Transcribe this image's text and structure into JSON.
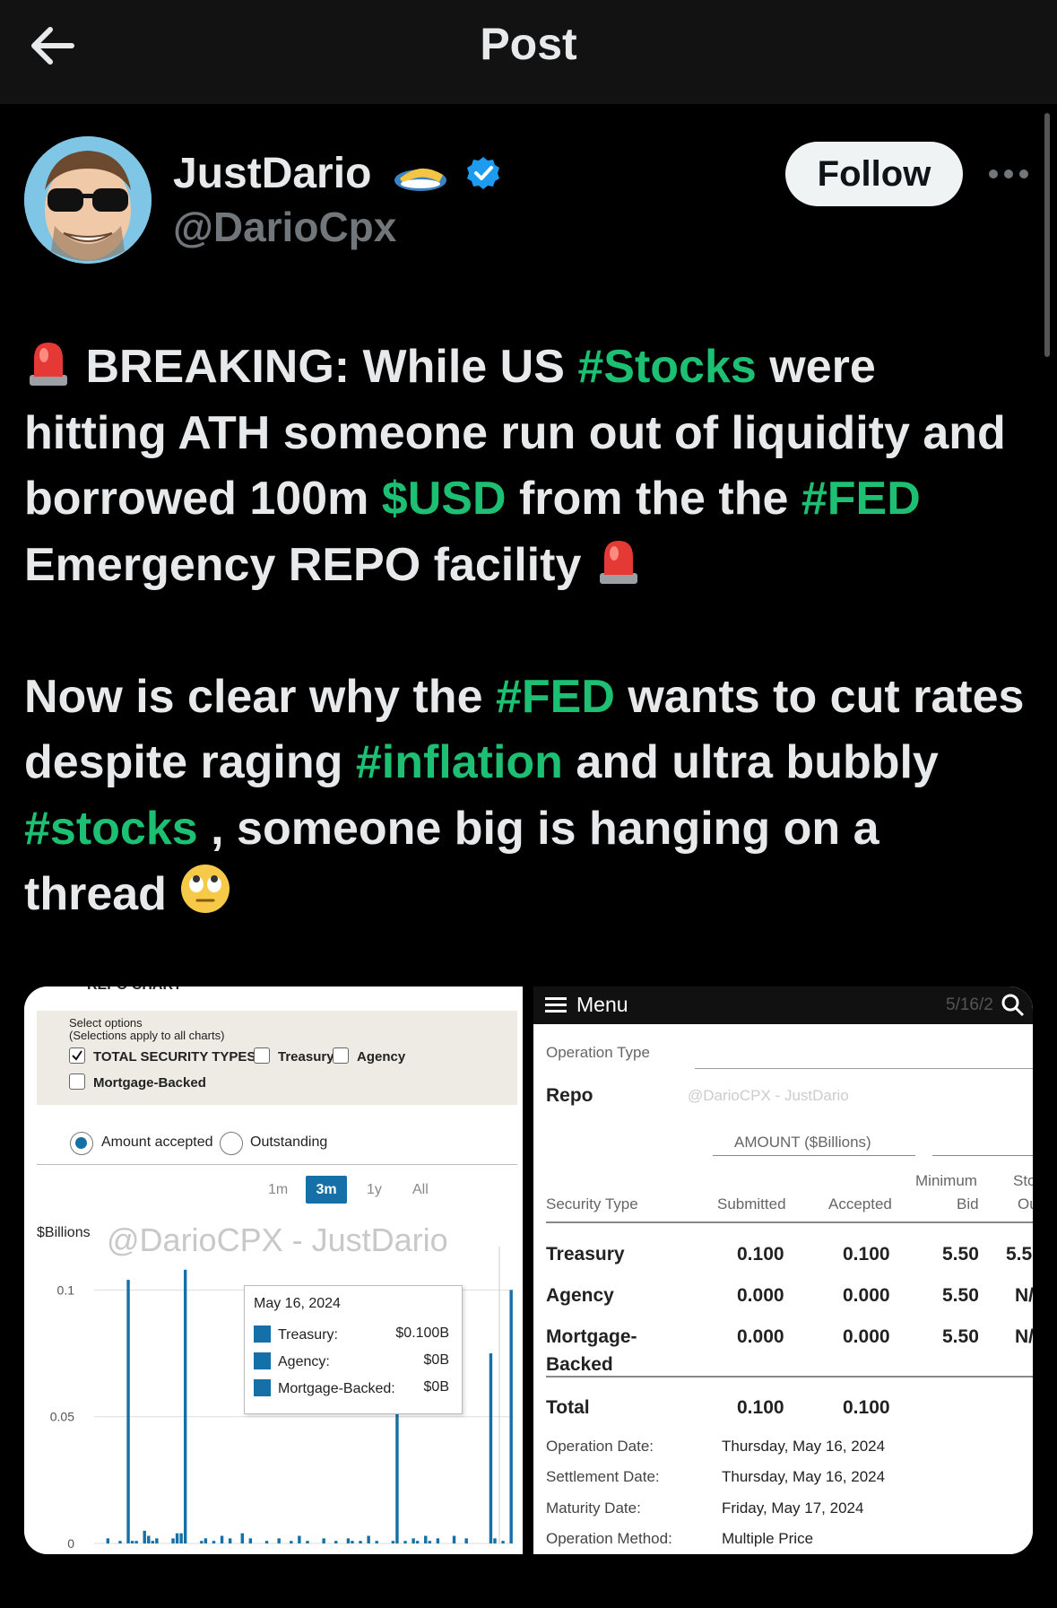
{
  "header": {
    "title": "Post"
  },
  "author": {
    "display_name": "JustDario",
    "handle": "@DarioCpx",
    "follow_label": "Follow"
  },
  "post": {
    "p1": {
      "t1": "BREAKING: While US ",
      "tag1": "#Stocks",
      "t2": " were hitting ATH someone run out of liquidity and borrowed 100m ",
      "tag2": "$USD",
      "t3": " from the the ",
      "tag3": "#FED",
      "t4": " Emergency REPO facility "
    },
    "p2": {
      "t1": "Now is clear why the ",
      "tag1": "#FED",
      "t2": " wants to cut rates despite raging ",
      "tag2": "#inflation",
      "t3": " and ultra bubbly ",
      "tag3": "#stocks",
      "t4": " , someone big is hanging on a thread "
    }
  },
  "image_left": {
    "cut_header": "REPO CHART",
    "select_title": "Select options",
    "select_sub": "(Selections apply to all charts)",
    "checks": [
      {
        "label": "TOTAL SECURITY TYPES",
        "checked": true
      },
      {
        "label": "Treasury",
        "checked": false
      },
      {
        "label": "Agency",
        "checked": false
      },
      {
        "label": "Mortgage-Backed",
        "checked": false
      }
    ],
    "radios": [
      {
        "label": "Amount accepted",
        "selected": true
      },
      {
        "label": "Outstanding",
        "selected": false
      }
    ],
    "ranges": [
      "1m",
      "3m",
      "1y",
      "All"
    ],
    "active_range": "3m",
    "watermark": "@DarioCPX - JustDario",
    "tooltip": {
      "date": "May 16, 2024",
      "rows": [
        {
          "label": "Treasury:",
          "value": "$0.100B"
        },
        {
          "label": "Agency:",
          "value": "$0B"
        },
        {
          "label": "Mortgage-Backed:",
          "value": "$0B"
        }
      ]
    }
  },
  "chart_data": {
    "type": "bar",
    "ylabel": "$Billions",
    "ylim": [
      0,
      0.115
    ],
    "yticks": [
      "0.1",
      "0.05",
      "0"
    ],
    "ytick_values": [
      0.1,
      0.05,
      0
    ],
    "values": [
      0,
      0,
      0,
      0.002,
      0,
      0,
      0.001,
      0,
      0.104,
      0.001,
      0.001,
      0,
      0.005,
      0.003,
      0.001,
      0.002,
      0,
      0,
      0,
      0.002,
      0.004,
      0.004,
      0.108,
      0,
      0,
      0,
      0.001,
      0.002,
      0,
      0.001,
      0,
      0.003,
      0,
      0.002,
      0,
      0,
      0.004,
      0,
      0.002,
      0,
      0,
      0,
      0.001,
      0,
      0,
      0.002,
      0,
      0,
      0.001,
      0,
      0.003,
      0,
      0.001,
      0,
      0,
      0,
      0.002,
      0,
      0,
      0.001,
      0,
      0,
      0.002,
      0.001,
      0,
      0.001,
      0,
      0.003,
      0,
      0.001,
      0,
      0,
      0,
      0.001,
      0.063,
      0,
      0.001,
      0,
      0.002,
      0.001,
      0,
      0.003,
      0.001,
      0,
      0.002,
      0,
      0,
      0,
      0.003,
      0,
      0,
      0.002,
      0,
      0,
      0,
      0,
      0,
      0.075,
      0.002,
      0,
      0.001,
      0,
      0.1
    ],
    "series": [
      {
        "name": "TOTAL SECURITY TYPES"
      }
    ],
    "grid": true
  },
  "image_right": {
    "menu_label": "Menu",
    "date_faint": "5/16/2",
    "operation_type_label": "Operation Type",
    "operation_type_value": "Repo",
    "watermark": "@DarioCPX - JustDario",
    "amount_header": "AMOUNT ($Billions)",
    "columns": [
      "Security Type",
      "Submitted",
      "Accepted",
      "Minimum",
      "Bid",
      "Sto",
      "Ou"
    ],
    "rows": [
      {
        "type": "Treasury",
        "submitted": "0.100",
        "accepted": "0.100",
        "min_bid": "5.50",
        "stop": "5.5"
      },
      {
        "type": "Agency",
        "submitted": "0.000",
        "accepted": "0.000",
        "min_bid": "5.50",
        "stop": "N/"
      },
      {
        "type": "Mortgage-",
        "type2": "Backed",
        "submitted": "0.000",
        "accepted": "0.000",
        "min_bid": "5.50",
        "stop": "N/"
      }
    ],
    "total": {
      "label": "Total",
      "submitted": "0.100",
      "accepted": "0.100"
    },
    "details": [
      {
        "label": "Operation Date:",
        "value": "Thursday, May 16, 2024"
      },
      {
        "label": "Settlement Date:",
        "value": "Thursday, May 16, 2024"
      },
      {
        "label": "Maturity Date:",
        "value": "Friday, May 17, 2024"
      },
      {
        "label": "Operation Method:",
        "value": "Multiple Price"
      }
    ]
  },
  "icons": [
    "back-arrow-icon",
    "verified-badge-icon",
    "sunglasses-emoji-icon",
    "more-options-icon",
    "siren-emoji-icon",
    "eye-roll-emoji-icon",
    "hamburger-menu-icon",
    "search-icon"
  ],
  "colors": {
    "hashtag": "#1dbf73",
    "verified": "#1d9bf0",
    "bar": "#1470a6",
    "background": "#000000"
  }
}
